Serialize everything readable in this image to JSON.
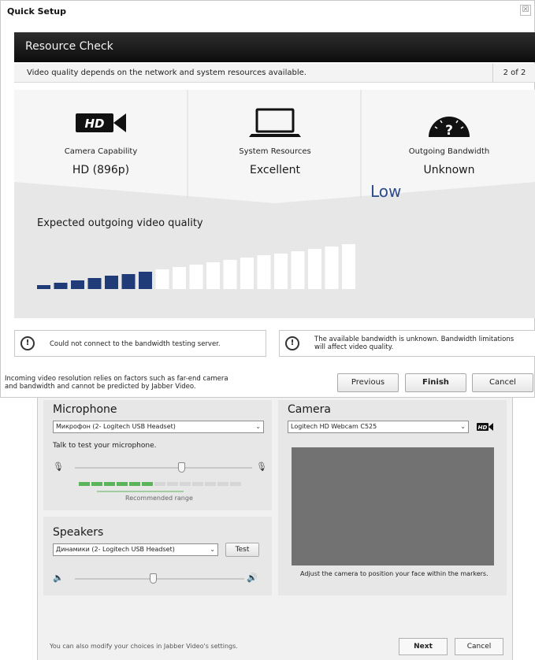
{
  "quick_setup": {
    "title": "Quick Setup",
    "close_glyph": "☒",
    "header": "Resource Check",
    "subheader": "Video quality depends on the network and system resources available.",
    "step": "2 of 2",
    "resources": [
      {
        "icon": "hd-camera-icon",
        "hd_text": "HD",
        "label": "Camera Capability",
        "value": "HD (896p)"
      },
      {
        "icon": "laptop-icon",
        "label": "System Resources",
        "value": "Excellent"
      },
      {
        "icon": "speedometer-icon",
        "gauge_text": "?",
        "label": "Outgoing Bandwidth",
        "value": "Unknown"
      }
    ],
    "quality": {
      "title": "Expected outgoing video quality",
      "value": "Low",
      "level": 7,
      "segments": 19
    },
    "notices": [
      {
        "icon_text": "!",
        "text": "Could not connect to the bandwidth testing server."
      },
      {
        "icon_text": "!",
        "line1": "The available bandwidth is unknown. Bandwidth limitations",
        "line2": "will affect video quality."
      }
    ],
    "footer_line1": "Incoming video resolution relies on factors such as far-end camera",
    "footer_line2": "and bandwidth and cannot be predicted by Jabber Video.",
    "buttons": {
      "previous": "Previous",
      "finish": "Finish",
      "cancel": "Cancel"
    }
  },
  "devices": {
    "microphone": {
      "title": "Microphone",
      "selected": "Микрофон (2- Logitech USB Headset)",
      "test_label": "Talk to test your microphone.",
      "recommended": "Recommended range",
      "level_segments": 13,
      "level_on": 6,
      "volume_percent": 60
    },
    "speakers": {
      "title": "Speakers",
      "selected": "Динамики (2- Logitech USB Headset)",
      "test_button": "Test",
      "volume_percent": 46
    },
    "camera": {
      "title": "Camera",
      "selected": "Logitech HD Webcam C525",
      "hd_badge": "HD",
      "hint": "Adjust the camera to position your face within the markers."
    },
    "footer_text": "You can also modify your choices in Jabber Video's settings.",
    "buttons": {
      "next": "Next",
      "cancel": "Cancel"
    }
  },
  "colors": {
    "header_bg": "#141414",
    "quality_active": "#1f3b78",
    "quality_value": "#2e4a8a",
    "level_green": "#5ab55a",
    "resource_bg": "#e7e7e7"
  }
}
